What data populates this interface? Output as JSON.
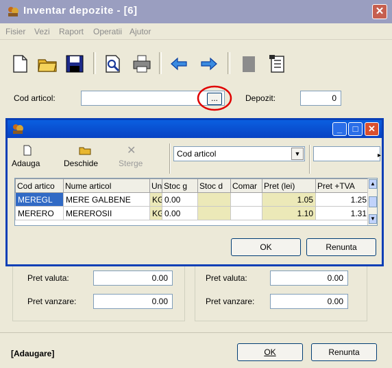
{
  "window": {
    "title": "Inventar depozite - [6]"
  },
  "menu": [
    "Fisier",
    "Vezi",
    "Raport",
    "Operatii",
    "Ajutor"
  ],
  "toolbar_icons": [
    "new-file-icon",
    "open-folder-icon",
    "save-icon",
    "preview-icon",
    "print-icon",
    "arrow-left-icon",
    "arrow-right-icon",
    "note-icon",
    "properties-icon"
  ],
  "form": {
    "cod_articol_label": "Cod articol:",
    "cod_articol_value": "",
    "browse_label": "...",
    "depozit_label": "Depozit:",
    "depozit_value": "0"
  },
  "popup": {
    "title": "",
    "adauga": "Adauga",
    "deschide": "Deschide",
    "sterge": "Sterge",
    "sort_select": "Cod articol",
    "search_value": "",
    "columns": [
      "Cod artico",
      "Nume articol",
      "Un",
      "Stoc g",
      "Stoc d",
      "Comar",
      "Pret (lei)",
      "Pret +TVA"
    ],
    "rows": [
      [
        "MEREGL",
        "MERE GALBENE",
        "KG",
        "0.00",
        "",
        "",
        "1.05",
        "1.25"
      ],
      [
        "MERERO",
        "MEREROSII",
        "KG",
        "0.00",
        "",
        "",
        "1.10",
        "1.31"
      ]
    ],
    "ok": "OK",
    "cancel": "Renunta"
  },
  "left_group": {
    "pret_valuta_label": "Pret valuta:",
    "pret_valuta": "0.00",
    "pret_vanzare_label": "Pret vanzare:",
    "pret_vanzare": "0.00"
  },
  "right_group": {
    "pret_valuta_label": "Pret valuta:",
    "pret_valuta": "0.00",
    "pret_vanzare_label": "Pret vanzare:",
    "pret_vanzare": "0.00"
  },
  "status": {
    "mode": "[Adaugare]"
  },
  "footer": {
    "ok": "OK",
    "cancel": "Renunta"
  },
  "colors": {
    "popup_border": "#0a3fb6",
    "highlight": "#ece9b8",
    "selection": "#316ac5",
    "annotation_circle": "#e00000"
  }
}
